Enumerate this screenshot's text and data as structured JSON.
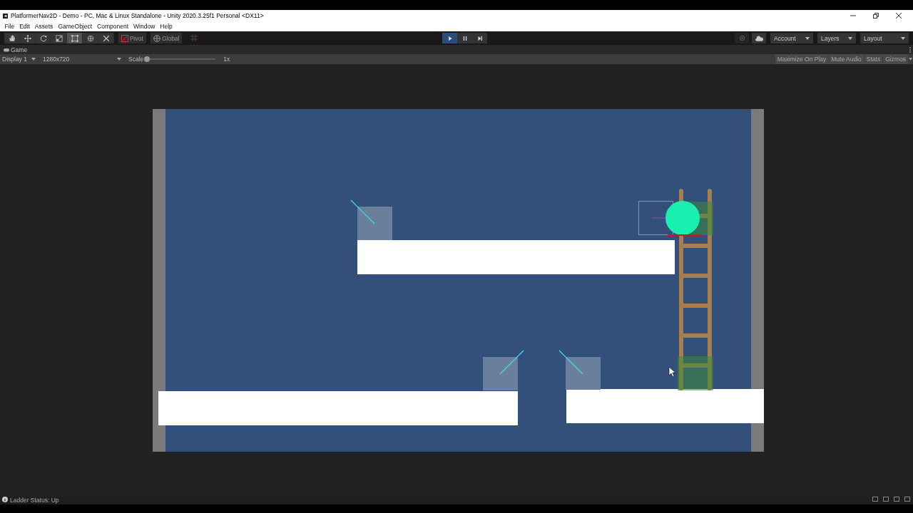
{
  "window": {
    "title": "PlatformerNav2D - Demo - PC, Mac & Linux Standalone - Unity 2020.3.25f1 Personal <DX11>"
  },
  "menu": [
    "File",
    "Edit",
    "Assets",
    "GameObject",
    "Component",
    "Window",
    "Help"
  ],
  "tools": [
    {
      "kind": "hand",
      "selected": false
    },
    {
      "kind": "move",
      "selected": false
    },
    {
      "kind": "rotate",
      "selected": false
    },
    {
      "kind": "scale",
      "selected": false
    },
    {
      "kind": "rect",
      "selected": true
    },
    {
      "kind": "transform",
      "selected": false
    },
    {
      "kind": "custom",
      "selected": false
    }
  ],
  "handle_buttons": [
    {
      "kind": "pivot",
      "label": "Pivot"
    },
    {
      "kind": "global",
      "label": "Global"
    }
  ],
  "playback": [
    {
      "kind": "play",
      "selected": true
    },
    {
      "kind": "pause",
      "selected": false
    },
    {
      "kind": "step",
      "selected": false
    }
  ],
  "right_dropdowns": [
    "Account",
    "Layers",
    "Layout"
  ],
  "game_tab": {
    "label": "Game"
  },
  "game_toolbar": {
    "display": "Display 1",
    "resolution": "1280x720",
    "scale_label": "Scale",
    "scale": {
      "level": 0
    },
    "scale_value": "1x",
    "toggles": [
      "Maximize On Play",
      "Mute Audio",
      "Stats",
      "Gizmos"
    ]
  },
  "status_bar": {
    "message": "Ladder Status: Up"
  }
}
